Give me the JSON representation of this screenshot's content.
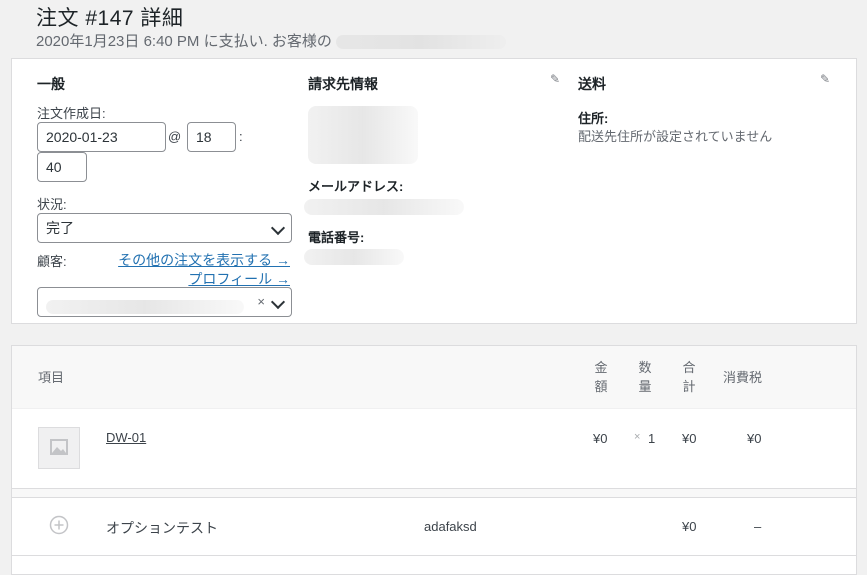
{
  "order": {
    "title": "注文 #147 詳細",
    "subtitle": "2020年1月23日 6:40 PM に支払い. お客様の"
  },
  "general": {
    "heading": "一般",
    "created_label": "注文作成日:",
    "date": "2020-01-23",
    "at": "@",
    "hour": "18",
    "colon": ":",
    "minute": "40",
    "status_label": "状況:",
    "status_value": "完了",
    "customer_label": "顧客:",
    "other_orders_link": "その他の注文を表示する →",
    "profile_link": "プロフィール →",
    "clear_x": "×"
  },
  "billing": {
    "heading": "請求先情報",
    "email_label": "メールアドレス:",
    "phone_label": "電話番号:"
  },
  "shipping": {
    "heading": "送料",
    "address_label": "住所:",
    "address_value": "配送先住所が設定されていません"
  },
  "items": {
    "headers": {
      "item": "項目",
      "price": "金\n額",
      "qty": "数\n量",
      "total": "合\n計",
      "tax": "消費税"
    },
    "product": {
      "name": "DW-01",
      "price": "¥0",
      "qty_x": "×",
      "qty": "1",
      "total": "¥0",
      "tax": "¥0"
    },
    "fee": {
      "name": "オプションテスト",
      "meta": "adafaksd",
      "total": "¥0",
      "tax": "–"
    }
  },
  "icons": {
    "edit": "pencil-icon",
    "add": "plus-circle-icon",
    "placeholder": "image-placeholder-icon"
  }
}
